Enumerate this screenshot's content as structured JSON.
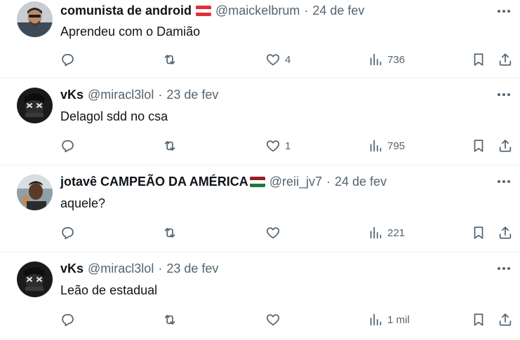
{
  "tweets": [
    {
      "name": "comunista de android",
      "flag": "austria",
      "handle": "@maickelbrum",
      "separator": "·",
      "date": "24 de fev",
      "text": "Aprendeu com o Damião",
      "likes": "4",
      "views": "736"
    },
    {
      "name": "vKs",
      "handle": "@miracl3lol",
      "separator": "·",
      "date": "23 de fev",
      "text": "Delagol sdd no csa",
      "likes": "1",
      "views": "795"
    },
    {
      "name": "jotavê CAMPEÃO DA AMÉRICA",
      "flag": "fluminense",
      "handle": "@reii_jv7",
      "separator": "·",
      "date": "24 de fev",
      "text": "aquele?",
      "likes": "",
      "views": "221"
    },
    {
      "name": "vKs",
      "handle": "@miracl3lol",
      "separator": "·",
      "date": "23 de fev",
      "text": "Leão de estadual",
      "likes": "",
      "views": "1 mil"
    }
  ],
  "icons": {
    "reply": "reply-icon",
    "retweet": "retweet-icon",
    "like": "heart-icon",
    "views": "views-chart-icon",
    "bookmark": "bookmark-icon",
    "share": "share-icon",
    "more": "more-dots-icon"
  },
  "colors": {
    "text_primary": "#0f1419",
    "text_secondary": "#536471",
    "divider": "#eff3f4"
  }
}
